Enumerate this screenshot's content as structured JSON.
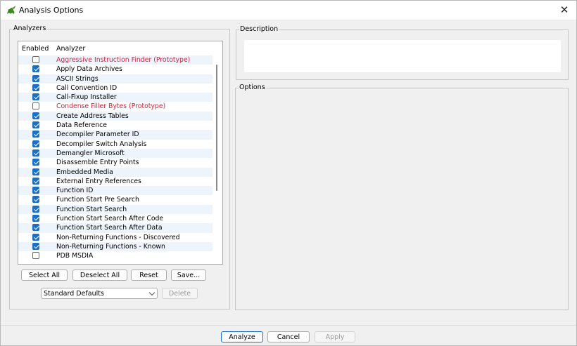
{
  "window": {
    "title": "Analysis Options",
    "close_glyph": "✕"
  },
  "analyzers": {
    "legend": "Analyzers",
    "columns": {
      "enabled": "Enabled",
      "analyzer": "Analyzer"
    },
    "items": [
      {
        "label": "Aggressive Instruction Finder (Prototype)",
        "enabled": false,
        "prototype": true
      },
      {
        "label": "Apply Data Archives",
        "enabled": true,
        "prototype": false
      },
      {
        "label": "ASCII Strings",
        "enabled": true,
        "prototype": false
      },
      {
        "label": "Call Convention ID",
        "enabled": true,
        "prototype": false
      },
      {
        "label": "Call-Fixup Installer",
        "enabled": true,
        "prototype": false
      },
      {
        "label": "Condense Filler Bytes (Prototype)",
        "enabled": false,
        "prototype": true
      },
      {
        "label": "Create Address Tables",
        "enabled": true,
        "prototype": false
      },
      {
        "label": "Data Reference",
        "enabled": true,
        "prototype": false
      },
      {
        "label": "Decompiler Parameter ID",
        "enabled": true,
        "prototype": false
      },
      {
        "label": "Decompiler Switch Analysis",
        "enabled": true,
        "prototype": false
      },
      {
        "label": "Demangler Microsoft",
        "enabled": true,
        "prototype": false
      },
      {
        "label": "Disassemble Entry Points",
        "enabled": true,
        "prototype": false
      },
      {
        "label": "Embedded Media",
        "enabled": true,
        "prototype": false
      },
      {
        "label": "External Entry References",
        "enabled": true,
        "prototype": false
      },
      {
        "label": "Function ID",
        "enabled": true,
        "prototype": false
      },
      {
        "label": "Function Start Pre Search",
        "enabled": true,
        "prototype": false
      },
      {
        "label": "Function Start Search",
        "enabled": true,
        "prototype": false
      },
      {
        "label": "Function Start Search After Code",
        "enabled": true,
        "prototype": false
      },
      {
        "label": "Function Start Search After Data",
        "enabled": true,
        "prototype": false
      },
      {
        "label": "Non-Returning Functions - Discovered",
        "enabled": true,
        "prototype": false
      },
      {
        "label": "Non-Returning Functions - Known",
        "enabled": true,
        "prototype": false
      },
      {
        "label": "PDB MSDIA",
        "enabled": false,
        "prototype": false
      }
    ],
    "buttons": {
      "select_all": "Select All",
      "deselect_all": "Deselect All",
      "reset": "Reset",
      "save": "Save..."
    },
    "profile": {
      "selected": "Standard Defaults"
    },
    "delete_label": "Delete"
  },
  "description": {
    "legend": "Description"
  },
  "options": {
    "legend": "Options"
  },
  "footer": {
    "analyze": "Analyze",
    "cancel": "Cancel",
    "apply": "Apply"
  },
  "colors": {
    "accent": "#1a6fc9",
    "prototype_text": "#d6213e",
    "alt_row": "#eef4fb"
  },
  "icons": {
    "app": "dragon-icon",
    "close": "close-icon",
    "checkbox": "checkbox-icon",
    "dropdown": "chevron-down-icon"
  }
}
